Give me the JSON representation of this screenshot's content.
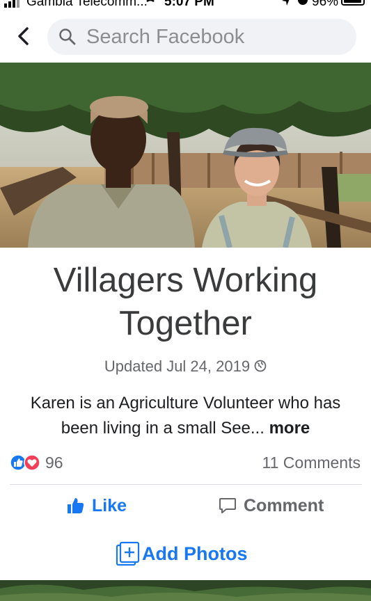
{
  "status_bar": {
    "carrier": "Gambia Telecomm...",
    "time": "5:07 PM",
    "battery": "96%"
  },
  "search": {
    "placeholder": "Search Facebook"
  },
  "post": {
    "title_line1": "Villagers Working",
    "title_line2": "Together",
    "updated": "Updated Jul 24, 2019",
    "description": "Karen is an Agriculture Volunteer who has been living in a small See...",
    "more_label": "more",
    "reaction_count": "96",
    "comments_count": "11 Comments",
    "like_label": "Like",
    "comment_label": "Comment",
    "add_photos_label": "Add Photos"
  },
  "colors": {
    "accent": "#1877f2",
    "love": "#f33e58",
    "secondary_text": "#65676b",
    "search_bg": "#f0f2f5"
  },
  "icons": [
    "back-chevron-icon",
    "search-icon",
    "globe-icon",
    "like-reaction-icon",
    "love-reaction-icon",
    "thumbs-up-icon",
    "comment-icon",
    "add-photo-icon"
  ]
}
